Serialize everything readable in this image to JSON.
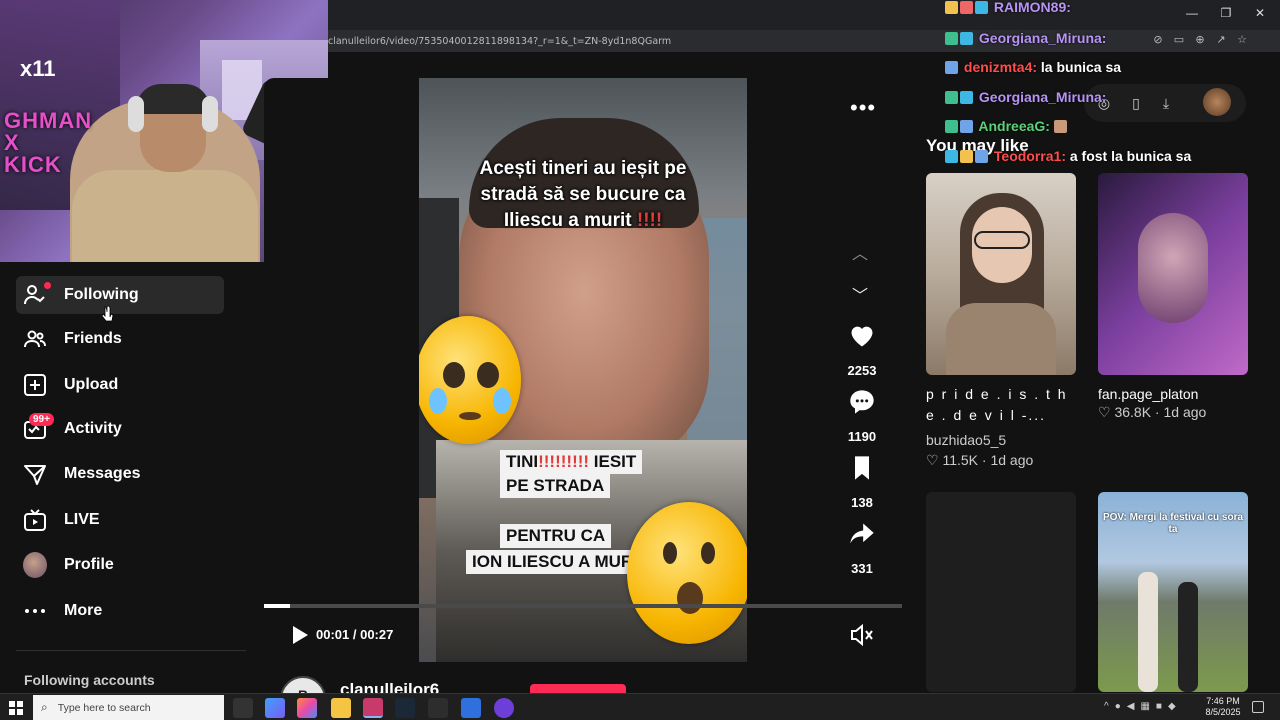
{
  "browser": {
    "url": "clanulleilor6/video/7535040012811898134?_r=1&_t=ZN-8yd1n8QGarm",
    "window_controls": [
      "—",
      "❐",
      "✕"
    ]
  },
  "webcam": {
    "logo": "x11",
    "poster_text": "GHMAN\nX\nKICK"
  },
  "nav": {
    "items": [
      {
        "label": "Following",
        "icon": "following-icon",
        "active": true
      },
      {
        "label": "Friends",
        "icon": "friends-icon"
      },
      {
        "label": "Upload",
        "icon": "upload-icon"
      },
      {
        "label": "Activity",
        "icon": "activity-icon",
        "badge": "99+"
      },
      {
        "label": "Messages",
        "icon": "messages-icon"
      },
      {
        "label": "LIVE",
        "icon": "live-icon"
      },
      {
        "label": "Profile",
        "icon": "profile-avatar"
      },
      {
        "label": "More",
        "icon": "more-icon"
      }
    ],
    "following_accounts": "Following accounts"
  },
  "video": {
    "caption_line1": "Acești tineri au ieșit pe",
    "caption_line2": "stradă să se bucure ca",
    "caption_line3": "Iliescu a murit",
    "caption_marks": "!!!!",
    "inset_box1_line1": "TINI",
    "inset_box1_marks": "!!!!!!!!!",
    "inset_box1_tail": " IESIT",
    "inset_box1_line2": "PE STRADA",
    "inset_box2_line1": "PENTRU CA",
    "inset_box2_line2": "ION ILIESCU A MUR",
    "time": "00:01 / 00:27",
    "progress": 0.04,
    "author": "clanulleilor6",
    "author_avatar": "B"
  },
  "actions": {
    "likes": "2253",
    "comments": "1190",
    "saves": "138",
    "shares": "331"
  },
  "chat": [
    {
      "user": "RAIMON89:",
      "color": "#b794f6",
      "msg": ""
    },
    {
      "user": "Georgiana_Miruna:",
      "color": "#b794f6",
      "msg": ""
    },
    {
      "user": "denizmta4:",
      "color": "#ff4d4d",
      "msg": "la bunica sa"
    },
    {
      "user": "Georgiana_Miruna:",
      "color": "#b794f6",
      "msg": ""
    },
    {
      "user": "AndreeaG:",
      "color": "#5ad17a",
      "msg": ""
    },
    {
      "user": "Teodorra1:",
      "color": "#ff4d4d",
      "msg": "a fost la bunica sa"
    }
  ],
  "recommendations": {
    "title": "You may like",
    "cards": [
      {
        "caption": "p r i d e . i s . t h e . d e v i l -...",
        "author": "buzhidao5_5",
        "likes": "11.5K",
        "age": "1d ago"
      },
      {
        "caption": "fan.page_platon",
        "author": "",
        "likes": "36.8K",
        "age": "1d ago"
      },
      {
        "caption": "",
        "author": "",
        "likes": "",
        "age": ""
      },
      {
        "overlay": "POV: Mergi la festival cu sora ta"
      }
    ]
  },
  "taskbar": {
    "search_placeholder": "Type here to search",
    "time": "7:46 PM",
    "date": "8/5/2025"
  },
  "colors": {
    "accent": "#fe2c55",
    "bg": "#121212"
  }
}
